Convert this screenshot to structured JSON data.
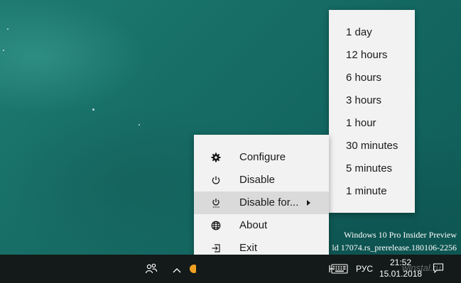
{
  "desktop": {
    "watermark_line1": "Windows 10 Pro Insider Preview",
    "watermark_line2": "ld 17074.rs_prerelease.180106-2256"
  },
  "context_menu": {
    "items": [
      {
        "label": "Configure",
        "icon": "gear-icon"
      },
      {
        "label": "Disable",
        "icon": "power-icon"
      },
      {
        "label": "Disable for...",
        "icon": "power-timer-icon",
        "has_submenu": true,
        "active": true
      },
      {
        "label": "About",
        "icon": "globe-icon"
      },
      {
        "label": "Exit",
        "icon": "exit-icon"
      }
    ]
  },
  "submenu": {
    "items": [
      {
        "label": "1 day"
      },
      {
        "label": "12 hours"
      },
      {
        "label": "6 hours"
      },
      {
        "label": "3 hours"
      },
      {
        "label": "1 hour"
      },
      {
        "label": "30 minutes"
      },
      {
        "label": "5 minutes"
      },
      {
        "label": "1 minute"
      }
    ]
  },
  "taskbar": {
    "language": "РУС",
    "time": "21:52",
    "date": "15.01.2018",
    "site_watermark": "winstal.ru"
  },
  "colors": {
    "menu_background": "#f2f2f2",
    "menu_highlight": "#dadada",
    "taskbar_background": "#141a19",
    "tray_app_orange": "#f0a020"
  }
}
